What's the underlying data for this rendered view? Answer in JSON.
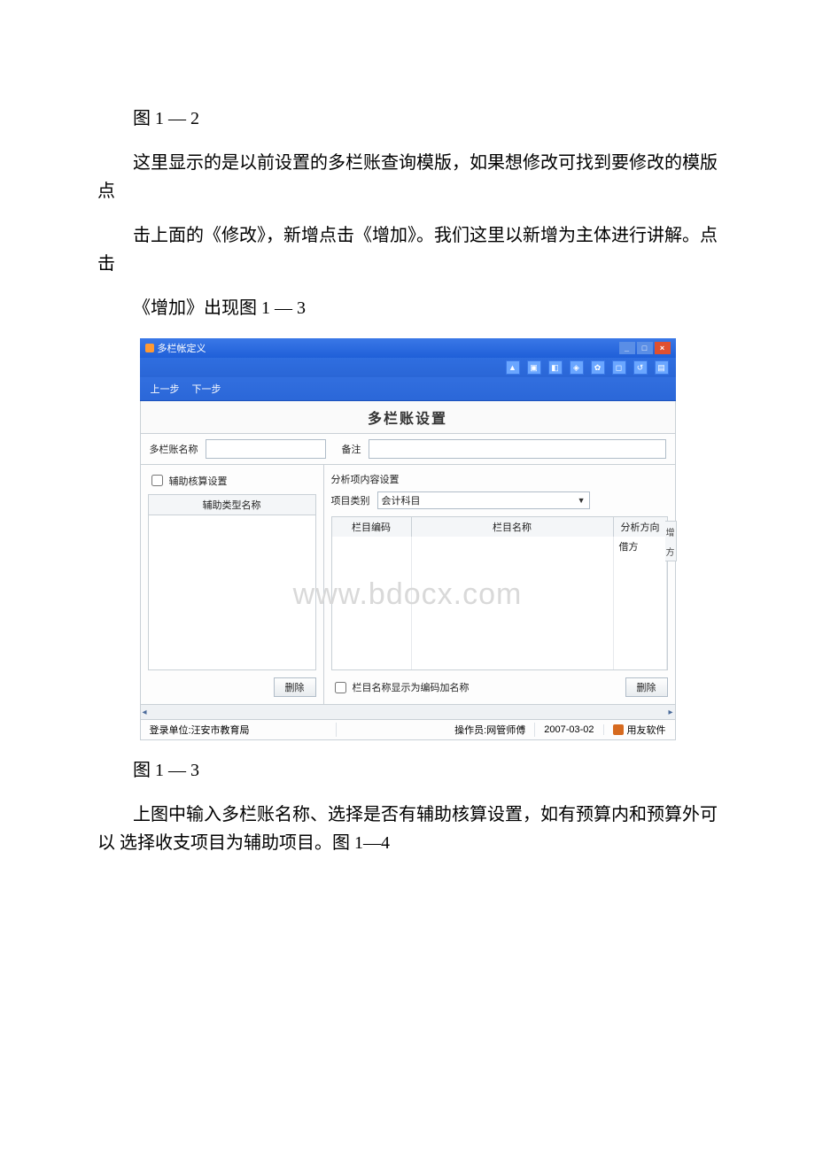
{
  "text": {
    "fig12": "图 1 — 2",
    "p1": "这里显示的是以前设置的多栏账查询模版，如果想修改可找到要修改的模版点",
    "p2": "击上面的《修改》，新增点击《增加》。我们这里以新增为主体进行讲解。点击",
    "p3": "《增加》出现图 1 — 3",
    "fig13": "图 1 — 3",
    "p4": "上图中输入多栏账名称、选择是否有辅助核算设置，如有预算内和预算外可以 选择收支项目为辅助项目。图 1—4"
  },
  "win": {
    "title": "多栏帐定义",
    "nav_prev": "上一步",
    "nav_next": "下一步",
    "panel_title": "多栏账设置",
    "lbl_name": "多栏账名称",
    "lbl_remark": "备注",
    "chk_aux": "辅助核算设置",
    "aux_list_header": "辅助类型名称",
    "btn_delete": "删除",
    "right_section": "分析项内容设置",
    "lbl_proj_type": "项目类别",
    "proj_type_value": "会计科目",
    "col_code": "栏目编码",
    "col_name": "栏目名称",
    "col_dir": "分析方向",
    "default_dir": "借方",
    "chk_name_as_code": "栏目名称显示为编码加名称",
    "btn_delete2": "删除",
    "side_tab1": "增",
    "side_tab2": "方",
    "status_login": "登录单位:汪安市教育局",
    "status_oper": "操作员:网管师傅",
    "status_date": "2007-03-02",
    "status_soft": "用友软件",
    "watermark": "www.bdocx.com"
  }
}
